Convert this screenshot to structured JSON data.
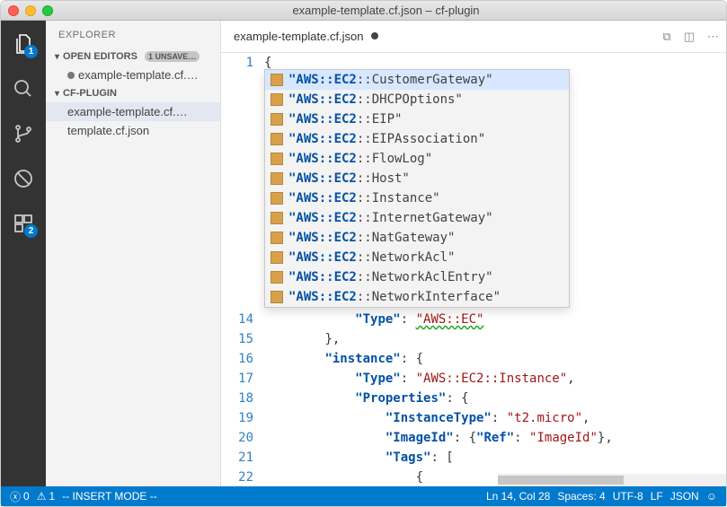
{
  "window": {
    "title": "example-template.cf.json – cf-plugin"
  },
  "activity": {
    "badges": {
      "explorer": "1",
      "extensions": "2"
    }
  },
  "sidebar": {
    "title": "EXPLORER",
    "sections": {
      "openEditors": {
        "label": "OPEN EDITORS",
        "badge": "1 UNSAVE…"
      },
      "project": {
        "label": "CF-PLUGIN"
      }
    },
    "openEditorItems": [
      {
        "label": "example-template.cf.…",
        "dirty": true
      }
    ],
    "projectItems": [
      {
        "label": "example-template.cf.…",
        "active": true
      },
      {
        "label": "template.cf.json",
        "active": false
      }
    ]
  },
  "tabs": {
    "active": {
      "label": "example-template.cf.json",
      "dirty": true
    }
  },
  "editor": {
    "topLine": {
      "num": "1",
      "text": "{"
    },
    "visible": [
      {
        "num": "14",
        "indent": "            ",
        "key": "\"Type\"",
        "sep": ": ",
        "val": "\"AWS::EC\"",
        "squiggle": true
      },
      {
        "num": "15",
        "indent": "        ",
        "plain": "},"
      },
      {
        "num": "16",
        "indent": "        ",
        "key": "\"instance\"",
        "sep": ": ",
        "plain2": "{"
      },
      {
        "num": "17",
        "indent": "            ",
        "key": "\"Type\"",
        "sep": ": ",
        "val": "\"AWS::EC2::Instance\"",
        "trail": ","
      },
      {
        "num": "18",
        "indent": "            ",
        "key": "\"Properties\"",
        "sep": ": ",
        "plain2": "{"
      },
      {
        "num": "19",
        "indent": "                ",
        "key": "\"InstanceType\"",
        "sep": ": ",
        "val": "\"t2.micro\"",
        "trail": ","
      },
      {
        "num": "20",
        "indent": "                ",
        "key": "\"ImageId\"",
        "sep": ": ",
        "plain2": "{",
        "key2": "\"Ref\"",
        "sep2": ": ",
        "val2": "\"ImageId\"",
        "close2": "},"
      },
      {
        "num": "21",
        "indent": "                ",
        "key": "\"Tags\"",
        "sep": ": ",
        "plain2": "["
      },
      {
        "num": "22",
        "indent": "                    ",
        "plain": "{"
      }
    ]
  },
  "suggestions": [
    {
      "prefix": "\"AWS::EC2",
      "rest": "::CustomerGateway\"",
      "selected": true
    },
    {
      "prefix": "\"AWS::EC2",
      "rest": "::DHCPOptions\""
    },
    {
      "prefix": "\"AWS::EC2",
      "rest": "::EIP\""
    },
    {
      "prefix": "\"AWS::EC2",
      "rest": "::EIPAssociation\""
    },
    {
      "prefix": "\"AWS::EC2",
      "rest": "::FlowLog\""
    },
    {
      "prefix": "\"AWS::EC2",
      "rest": "::Host\""
    },
    {
      "prefix": "\"AWS::EC2",
      "rest": "::Instance\""
    },
    {
      "prefix": "\"AWS::EC2",
      "rest": "::InternetGateway\""
    },
    {
      "prefix": "\"AWS::EC2",
      "rest": "::NatGateway\""
    },
    {
      "prefix": "\"AWS::EC2",
      "rest": "::NetworkAcl\""
    },
    {
      "prefix": "\"AWS::EC2",
      "rest": "::NetworkAclEntry\""
    },
    {
      "prefix": "\"AWS::EC2",
      "rest": "::NetworkInterface\""
    }
  ],
  "status": {
    "errors": "0",
    "warnings": "1",
    "mode": "-- INSERT MODE --",
    "pos": "Ln 14, Col 28",
    "spaces": "Spaces: 4",
    "encoding": "UTF-8",
    "eol": "LF",
    "lang": "JSON"
  }
}
